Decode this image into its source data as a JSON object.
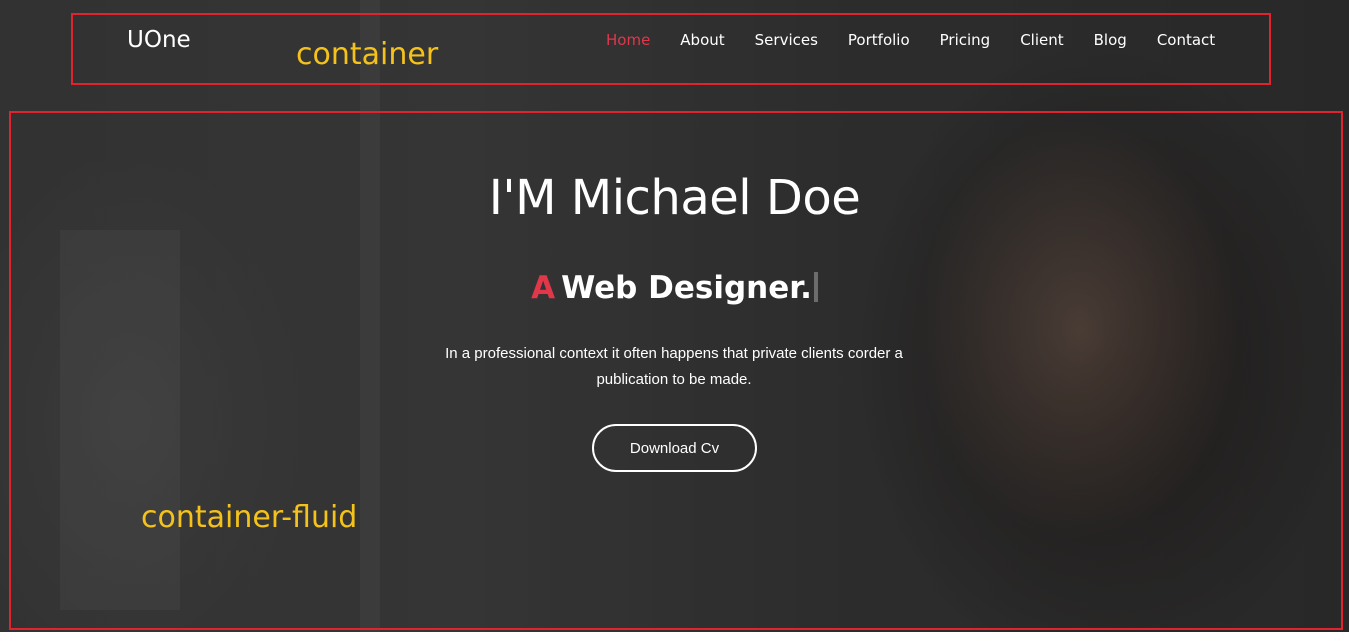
{
  "navbar": {
    "brand": "UOne",
    "items": [
      {
        "label": "Home",
        "active": true
      },
      {
        "label": "About"
      },
      {
        "label": "Services"
      },
      {
        "label": "Portfolio"
      },
      {
        "label": "Pricing"
      },
      {
        "label": "Client"
      },
      {
        "label": "Blog"
      },
      {
        "label": "Contact"
      }
    ],
    "active_color": "#e0374b"
  },
  "annotations": {
    "container_label": "container",
    "fluid_label": "container-fluid",
    "box_color": "#e0232e",
    "label_color": "#f4c21a"
  },
  "hero": {
    "title": "I'M Michael Doe",
    "subtitle_prefix": "A",
    "subtitle_text": "Web Designer.",
    "description": "In a professional context it often happens that private clients corder a publication to be made.",
    "button_label": "Download Cv"
  }
}
